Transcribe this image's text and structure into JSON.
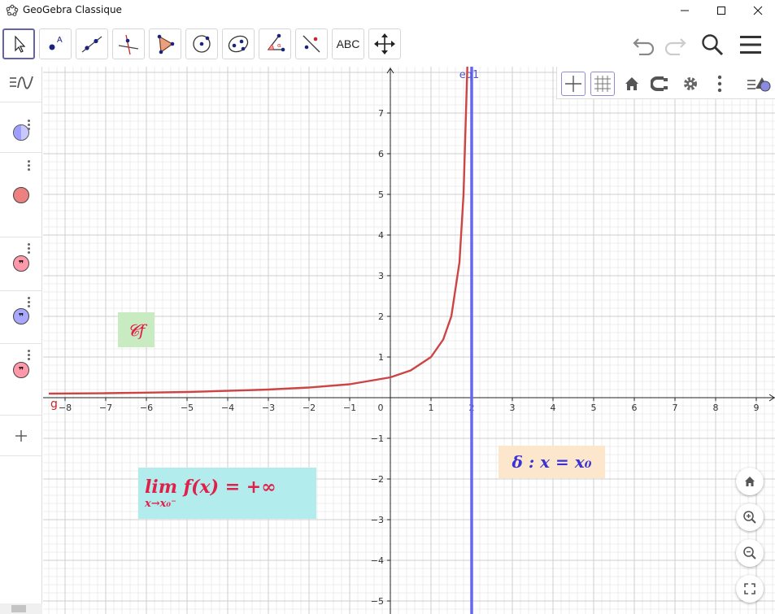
{
  "window": {
    "title": "GeoGebra Classique",
    "minimize_icon": "minimize-icon",
    "maximize_icon": "maximize-icon",
    "close_icon": "close-icon"
  },
  "toolbar": {
    "tools": [
      {
        "name": "move-tool",
        "icon": "cursor-arrow-icon"
      },
      {
        "name": "point-tool",
        "icon": "point-icon"
      },
      {
        "name": "line-tool",
        "icon": "line-icon"
      },
      {
        "name": "perpendicular-tool",
        "icon": "perpendicular-line-icon"
      },
      {
        "name": "polygon-tool",
        "icon": "polygon-icon"
      },
      {
        "name": "circle-tool",
        "icon": "circle-center-point-icon"
      },
      {
        "name": "conic-tool",
        "icon": "ellipse-icon"
      },
      {
        "name": "angle-tool",
        "icon": "angle-icon"
      },
      {
        "name": "reflect-tool",
        "icon": "reflect-line-icon"
      },
      {
        "name": "text-tool",
        "label": "ABC"
      },
      {
        "name": "move-view-tool",
        "icon": "move-view-icon"
      }
    ],
    "right_icons": [
      "undo-icon",
      "redo-icon",
      "search-icon",
      "menu-icon"
    ]
  },
  "algebra_view": {
    "toggle_icon": "algebra-toggle-icon",
    "items": [
      {
        "name": "object-1",
        "color": "#9f9fff",
        "icon": "half-filled-circle-icon"
      },
      {
        "name": "object-2",
        "color": "#ee8080",
        "icon": "filled-circle-icon"
      },
      {
        "name": "text-item-1",
        "color": "#ff99aa",
        "icon": "quote-icon"
      },
      {
        "name": "text-item-2",
        "color": "#a8a8ff",
        "icon": "quote-icon"
      },
      {
        "name": "text-item-3",
        "color": "#ff99aa",
        "icon": "quote-icon"
      }
    ],
    "add_icon": "plus-icon"
  },
  "style_bar": {
    "buttons": [
      "axes-toggle-icon",
      "grid-toggle-icon",
      "home-icon",
      "point-capture-icon",
      "settings-gear-icon",
      "more-options-icon",
      "style-bar-toggle-icon"
    ]
  },
  "graphics": {
    "x_ticks": [
      "−8",
      "−7",
      "−6",
      "−5",
      "−4",
      "−3",
      "−2",
      "−1",
      "0",
      "1",
      "2",
      "3",
      "4",
      "5",
      "6",
      "7",
      "8",
      "9"
    ],
    "y_ticks_pos": [
      "1",
      "2",
      "3",
      "4",
      "5",
      "6",
      "7"
    ],
    "y_ticks_neg": [
      "−1",
      "−2",
      "−3",
      "−4",
      "−5"
    ],
    "curve_label": "g",
    "asymptote_label": "eq1",
    "curve_color": "#cc4444",
    "asymptote_color": "#6666ee",
    "labels": {
      "cf": "𝓒f",
      "limit_text": "lim f(x) = +∞",
      "limit_sub": "x→x₀⁻",
      "delta_text": "δ : x = x₀"
    },
    "label_colors": {
      "cf_bg": "#c8ebc1",
      "cf_fg": "#e0204a",
      "limit_bg": "#b2ecec",
      "limit_fg": "#e0204a",
      "delta_bg": "#fde7cc",
      "delta_fg": "#3a32d4"
    }
  },
  "float_buttons": [
    "home-icon",
    "zoom-in-icon",
    "zoom-out-icon",
    "fullscreen-icon"
  ],
  "chart_data": {
    "type": "line",
    "xlim": [
      -8.4,
      9.4
    ],
    "ylim": [
      -5.3,
      8.1
    ],
    "series": [
      {
        "name": "g",
        "x": [
          -8.4,
          -7,
          -6,
          -5,
          -4,
          -3,
          -2,
          -1,
          0,
          0.5,
          1,
          1.3,
          1.5,
          1.7,
          1.8,
          1.85,
          1.9
        ],
        "y": [
          0.1,
          0.11,
          0.125,
          0.14,
          0.167,
          0.2,
          0.25,
          0.33,
          0.5,
          0.67,
          1,
          1.43,
          2,
          3.33,
          5,
          6.67,
          10
        ]
      }
    ],
    "vertical_line": {
      "x": 2,
      "label": "eq1"
    },
    "grid": true
  }
}
